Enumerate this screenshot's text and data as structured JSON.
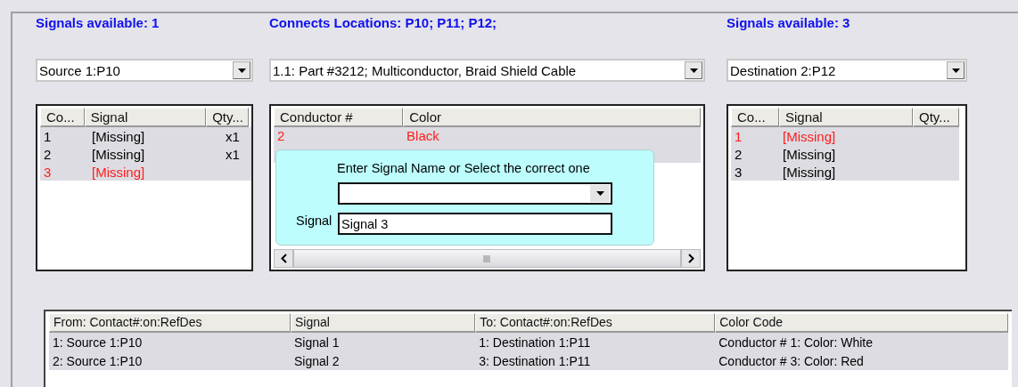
{
  "source": {
    "title": "Signals available: 1",
    "dropdown": "Source 1:P10",
    "columns": [
      "Co...",
      "Signal",
      "Qty..."
    ],
    "rows": [
      {
        "cells": [
          "1",
          "[Missing]",
          "x1"
        ],
        "flagged": false
      },
      {
        "cells": [
          "2",
          "[Missing]",
          "x1"
        ],
        "flagged": false
      },
      {
        "cells": [
          "3",
          "[Missing]",
          ""
        ],
        "flagged": true
      }
    ]
  },
  "cable": {
    "title": "Connects Locations: P10; P11; P12;",
    "dropdown": "1.1: Part #3212; Multiconductor, Braid Shield Cable",
    "columns": [
      "Conductor #",
      "Color"
    ],
    "rows": [
      {
        "cells": [
          "2",
          "Black"
        ],
        "flagged": true
      }
    ],
    "popup": {
      "prompt": "Enter Signal Name or Select the correct one",
      "signal_label": "Signal",
      "signal_value": "Signal 3"
    }
  },
  "destination": {
    "title": "Signals available: 3",
    "dropdown": "Destination 2:P12",
    "columns": [
      "Co...",
      "Signal",
      "Qty..."
    ],
    "rows": [
      {
        "cells": [
          "1",
          "[Missing]",
          ""
        ],
        "flagged": true
      },
      {
        "cells": [
          "2",
          "[Missing]",
          ""
        ],
        "flagged": false
      },
      {
        "cells": [
          "3",
          "[Missing]",
          ""
        ],
        "flagged": false
      }
    ]
  },
  "connections": {
    "columns": [
      "From: Contact#:on:RefDes",
      "Signal",
      "To: Contact#:on:RefDes",
      "Color Code"
    ],
    "rows": [
      {
        "cells": [
          "1: Source 1:P10",
          "Signal 1",
          "1: Destination 1:P11",
          "Conductor # 1: Color: White"
        ]
      },
      {
        "cells": [
          "2: Source 1:P10",
          "Signal 2",
          "3: Destination 1:P11",
          "Conductor # 3: Color: Red"
        ]
      }
    ]
  }
}
